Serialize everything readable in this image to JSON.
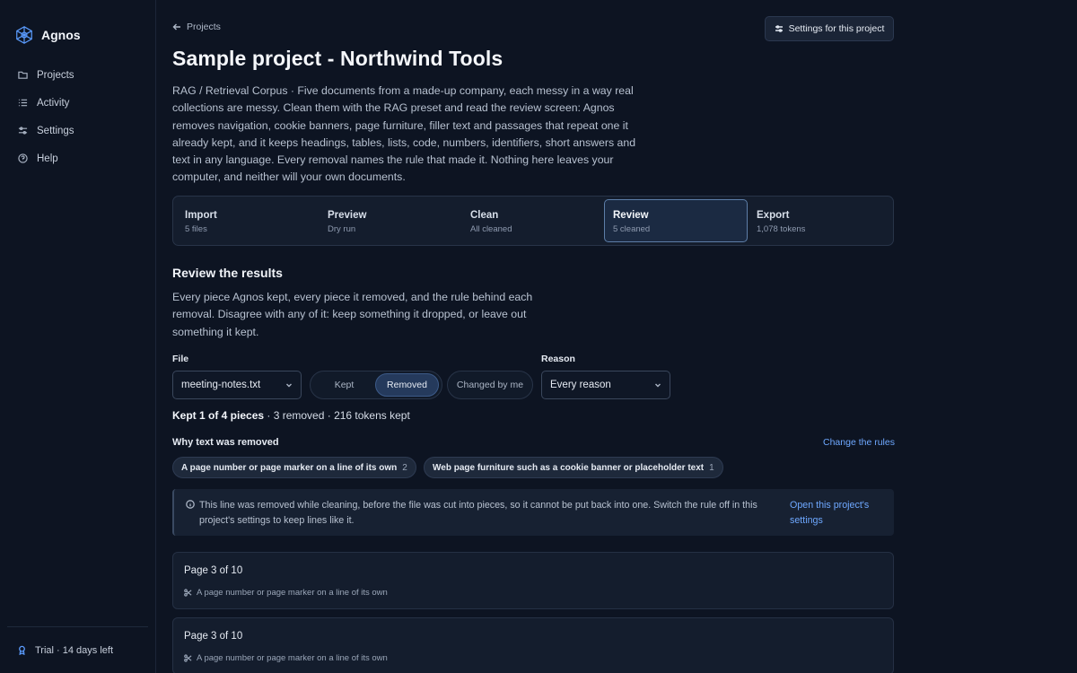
{
  "app": {
    "name": "Agnos"
  },
  "sidebar": {
    "items": [
      {
        "label": "Projects",
        "icon": "folder-icon"
      },
      {
        "label": "Activity",
        "icon": "list-icon"
      },
      {
        "label": "Settings",
        "icon": "sliders-icon"
      },
      {
        "label": "Help",
        "icon": "help-circle-icon"
      }
    ],
    "footer": "Trial · 14 days left"
  },
  "header": {
    "back_label": "Projects",
    "settings_button": "Settings for this project",
    "title": "Sample project - Northwind Tools",
    "description": "RAG / Retrieval Corpus · Five documents from a made-up company, each messy in a way real collections are messy. Clean them with the RAG preset and read the review screen: Agnos removes navigation, cookie banners, page furniture, filler text and passages that repeat one it already kept, and it keeps headings, tables, lists, code, numbers, identifiers, short answers and text in any language. Every removal names the rule that made it. Nothing here leaves your computer, and neither will your own documents."
  },
  "steps": [
    {
      "title": "Import",
      "sub": "5 files"
    },
    {
      "title": "Preview",
      "sub": "Dry run"
    },
    {
      "title": "Clean",
      "sub": "All cleaned"
    },
    {
      "title": "Review",
      "sub": "5 cleaned"
    },
    {
      "title": "Export",
      "sub": "1,078 tokens"
    }
  ],
  "review": {
    "title": "Review the results",
    "description": "Every piece Agnos kept, every piece it removed, and the rule behind each removal. Disagree with any of it: keep something it dropped, or leave out something it kept.",
    "file_label": "File",
    "file_value": "meeting-notes.txt",
    "kept_label": "Kept",
    "removed_label": "Removed",
    "changed_label": "Changed by me",
    "reason_label": "Reason",
    "reason_value": "Every reason",
    "summary_strong": "Kept 1 of 4 pieces",
    "summary_rest": " · 3 removed · 216 tokens kept",
    "why_title": "Why text was removed",
    "change_rules": "Change the rules",
    "chips": [
      {
        "label": "A page number or page marker on a line of its own",
        "count": "2"
      },
      {
        "label": "Web page furniture such as a cookie banner or placeholder text",
        "count": "1"
      }
    ],
    "info_text": "This line was removed while cleaning, before the file was cut into pieces, so it cannot be put back into one. Switch the rule off in this project's settings to keep lines like it.",
    "info_link": "Open this project's settings",
    "cards": [
      {
        "title": "Page 3 of 10",
        "rule": "A page number or page marker on a line of its own"
      },
      {
        "title": "Page 3 of 10",
        "rule": "A page number or page marker on a line of its own"
      }
    ]
  },
  "colors": {
    "accent": "#6ea8ff",
    "background": "#0d1422",
    "surface": "#141d2d"
  }
}
